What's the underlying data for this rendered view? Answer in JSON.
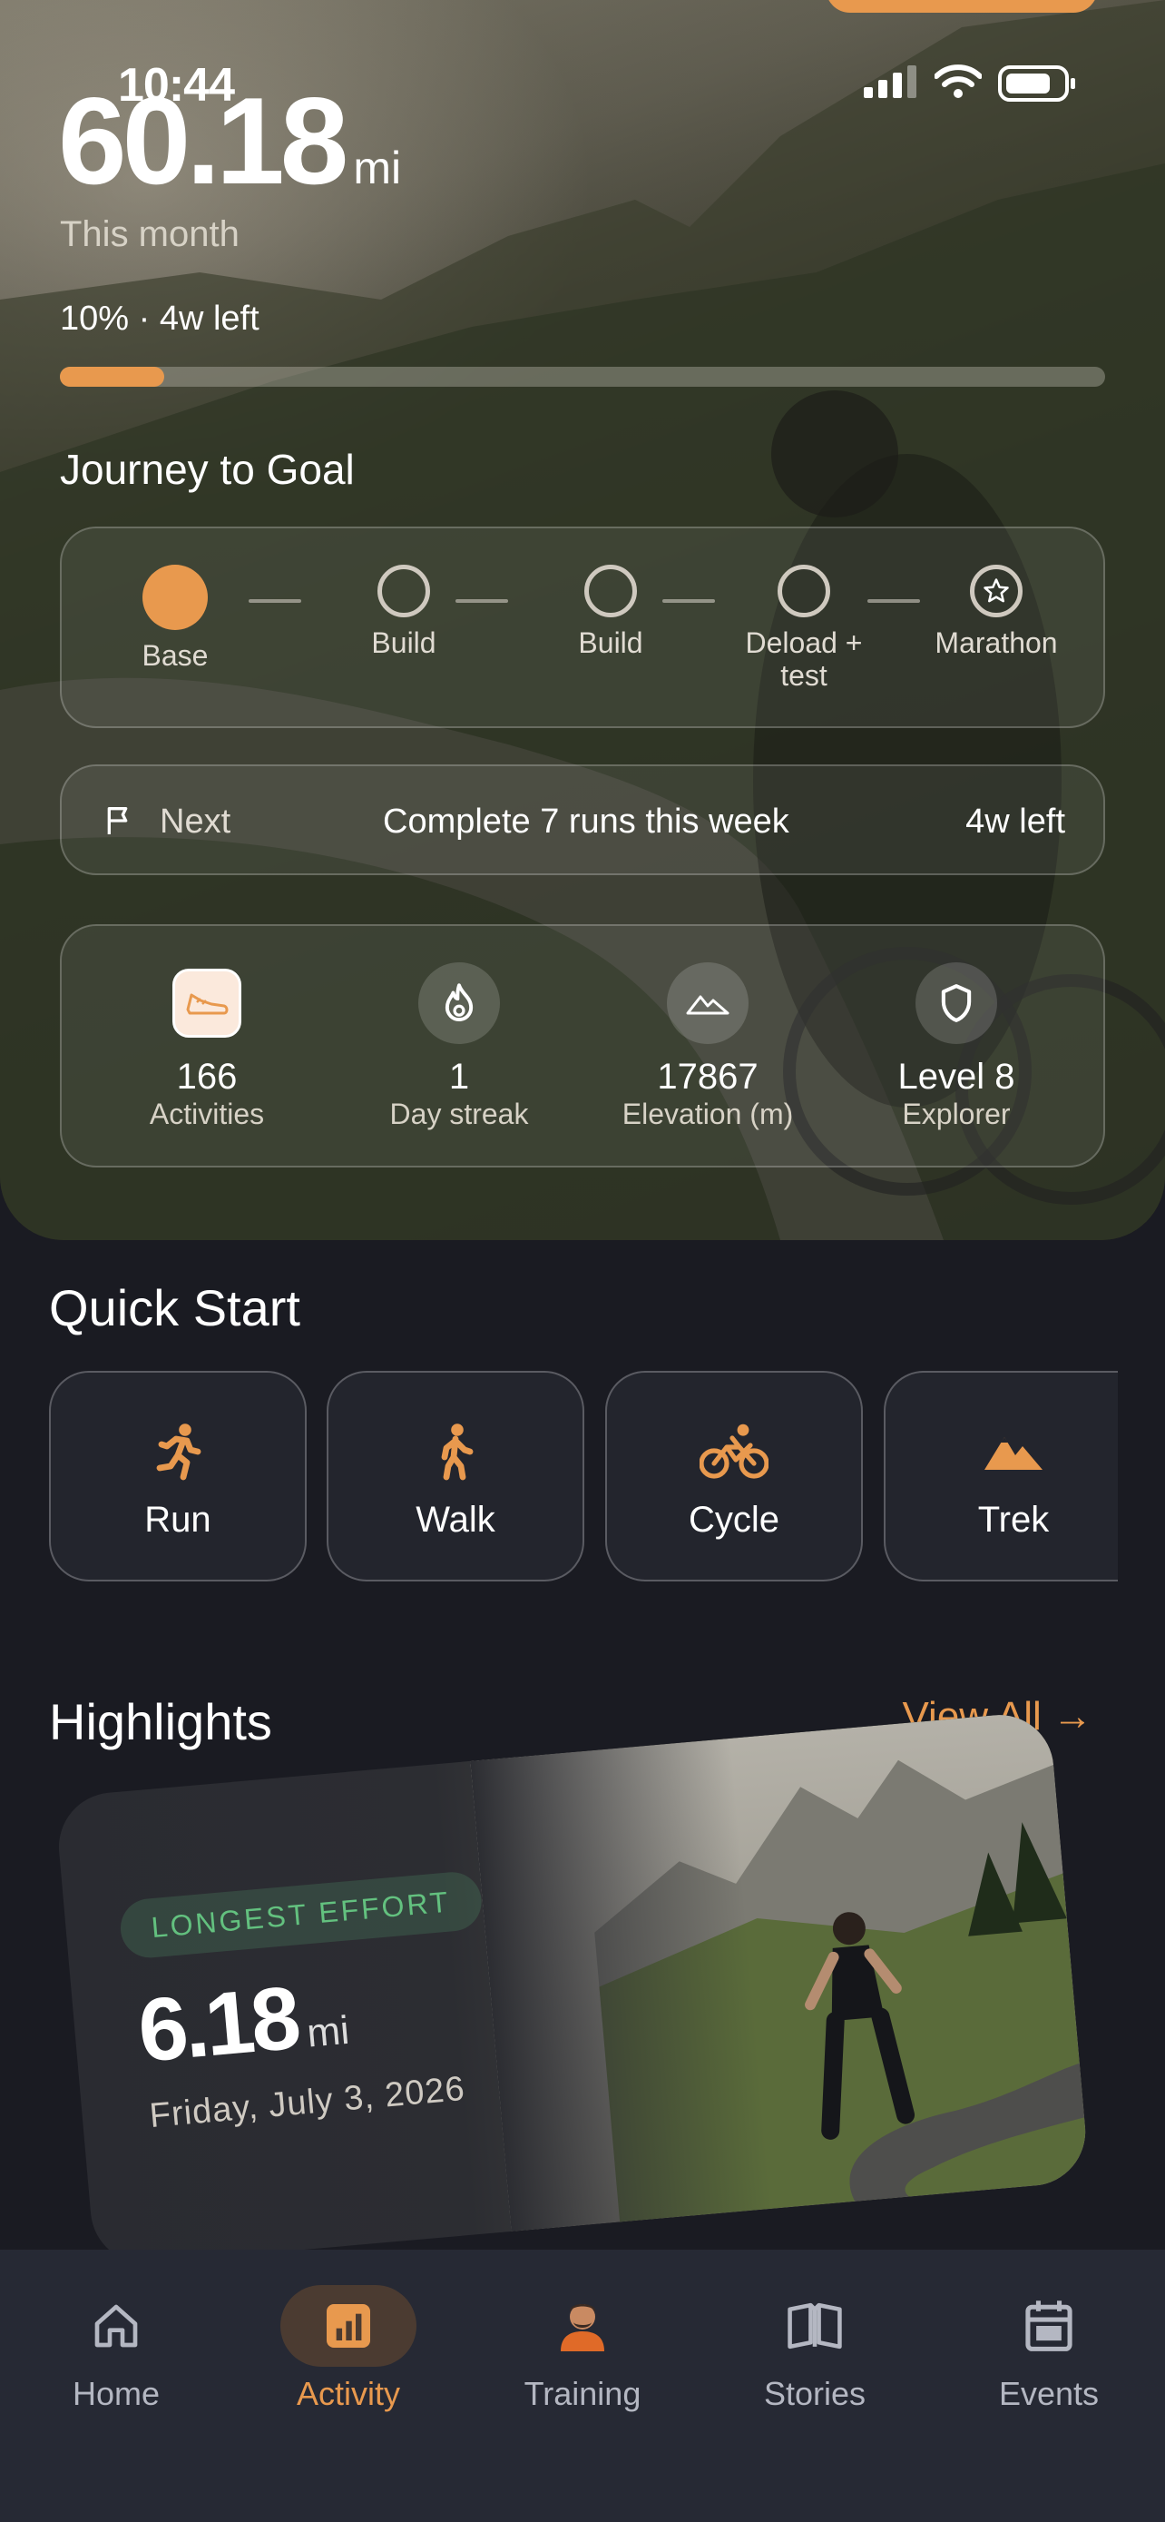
{
  "status": {
    "time": "10:44"
  },
  "hero": {
    "distance": "60.18",
    "distance_unit": "mi",
    "period": "This month",
    "progress_text": "10% · 4w left",
    "progress_fraction": 0.1,
    "journey_title": "Journey to Goal",
    "steps": [
      {
        "label": "Base",
        "state": "done"
      },
      {
        "label": "Build",
        "state": "upcoming"
      },
      {
        "label": "Build",
        "state": "upcoming"
      },
      {
        "label": "Deload + test",
        "state": "upcoming"
      },
      {
        "label": "Marathon",
        "state": "goal"
      }
    ],
    "next": {
      "label": "Next",
      "message": "Complete 7 runs this week",
      "time_left": "4w left"
    },
    "stats": [
      {
        "value": "166",
        "label": "Activities",
        "icon": "shoe-icon"
      },
      {
        "value": "1",
        "label": "Day streak",
        "icon": "flame-icon"
      },
      {
        "value": "17867",
        "label": "Elevation (m)",
        "icon": "mountain-icon"
      },
      {
        "value": "Level 8",
        "label": "Explorer",
        "icon": "shield-icon"
      }
    ]
  },
  "quick_start": {
    "title": "Quick Start",
    "items": [
      {
        "label": "Run",
        "icon": "run-icon"
      },
      {
        "label": "Walk",
        "icon": "walk-icon"
      },
      {
        "label": "Cycle",
        "icon": "cycle-icon"
      },
      {
        "label": "Trek",
        "icon": "trek-icon"
      }
    ]
  },
  "highlights": {
    "title": "Highlights",
    "view_all": "View All →",
    "card": {
      "badge": "LONGEST EFFORT",
      "value": "6.18",
      "unit": "mi",
      "date": "Friday, July 3, 2026"
    }
  },
  "nav": [
    {
      "label": "Home",
      "icon": "home-icon"
    },
    {
      "label": "Activity",
      "icon": "activity-icon",
      "active": true
    },
    {
      "label": "Training",
      "icon": "coach-avatar-icon"
    },
    {
      "label": "Stories",
      "icon": "book-icon"
    },
    {
      "label": "Events",
      "icon": "calendar-icon"
    }
  ],
  "colors": {
    "accent": "#e8994e",
    "background": "#1a1b22",
    "nav_bg": "#262934",
    "badge_green": "#63c17f"
  }
}
